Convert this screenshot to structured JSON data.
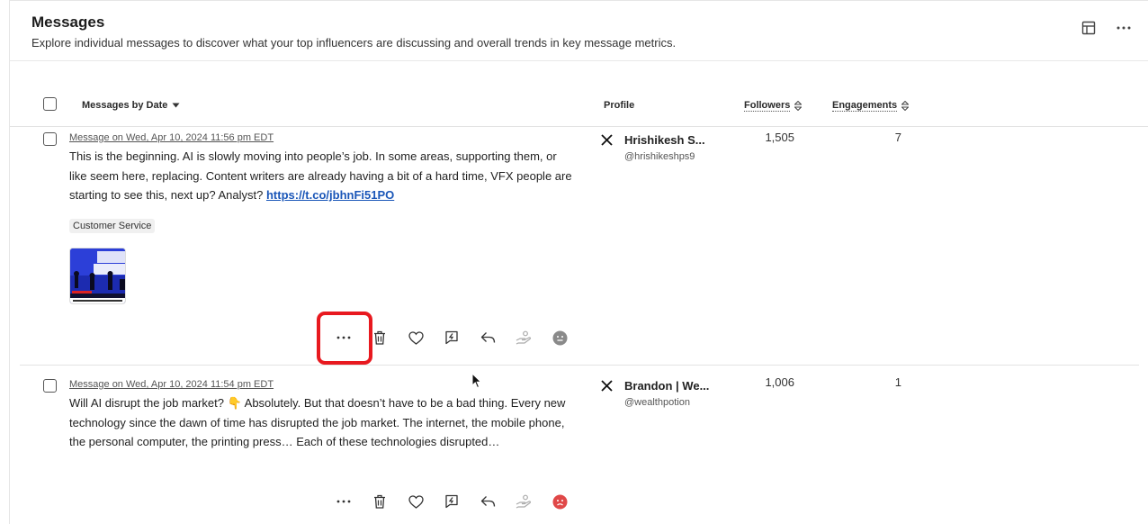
{
  "header": {
    "title": "Messages",
    "subtitle": "Explore individual messages to discover what your top influencers are discussing and overall trends in key message metrics.",
    "icons": [
      "table-icon",
      "more-horizontal-icon"
    ]
  },
  "table": {
    "columns": {
      "messages": "Messages by Date",
      "profile": "Profile",
      "followers": "Followers",
      "engagements": "Engagements"
    },
    "rows": [
      {
        "link": "Message on Wed, Apr 10, 2024 11:56 pm EDT",
        "text": "This is the beginning. AI is slowly moving into people’s job. In some areas, supporting them, or like seem here, replacing. Content writers are already having a bit of a hard time, VFX people are starting to see this, next up? Analyst? ",
        "url": "https://t.co/jbhnFi51PO",
        "tag": "Customer Service",
        "profile_name": "Hrishikesh S...",
        "profile_handle": "@hrishikeshps9",
        "followers": "1,505",
        "engagements": "7",
        "sentiment": "neutral"
      },
      {
        "link": "Message on Wed, Apr 10, 2024 11:54 pm EDT",
        "text": "Will AI disrupt the job market? 👇 Absolutely. But that doesn’t have to be a bad thing. Every new technology since the dawn of time has disrupted the job market. The internet, the mobile phone, the personal computer, the printing press… Each of these technologies disrupted…",
        "profile_name": "Brandon | We...",
        "profile_handle": "@wealthpotion",
        "followers": "1,006",
        "engagements": "1",
        "sentiment": "negative"
      }
    ],
    "action_icons": [
      "more-horizontal-icon",
      "trash-icon",
      "heart-icon",
      "quick-reply-icon",
      "reply-icon",
      "hand-donate-icon",
      "sentiment-icon"
    ]
  },
  "colors": {
    "highlight": "#e8191f",
    "link": "#1a56b8",
    "sentiment_neutral": "#8a8a8a",
    "sentiment_negative": "#e04848"
  }
}
